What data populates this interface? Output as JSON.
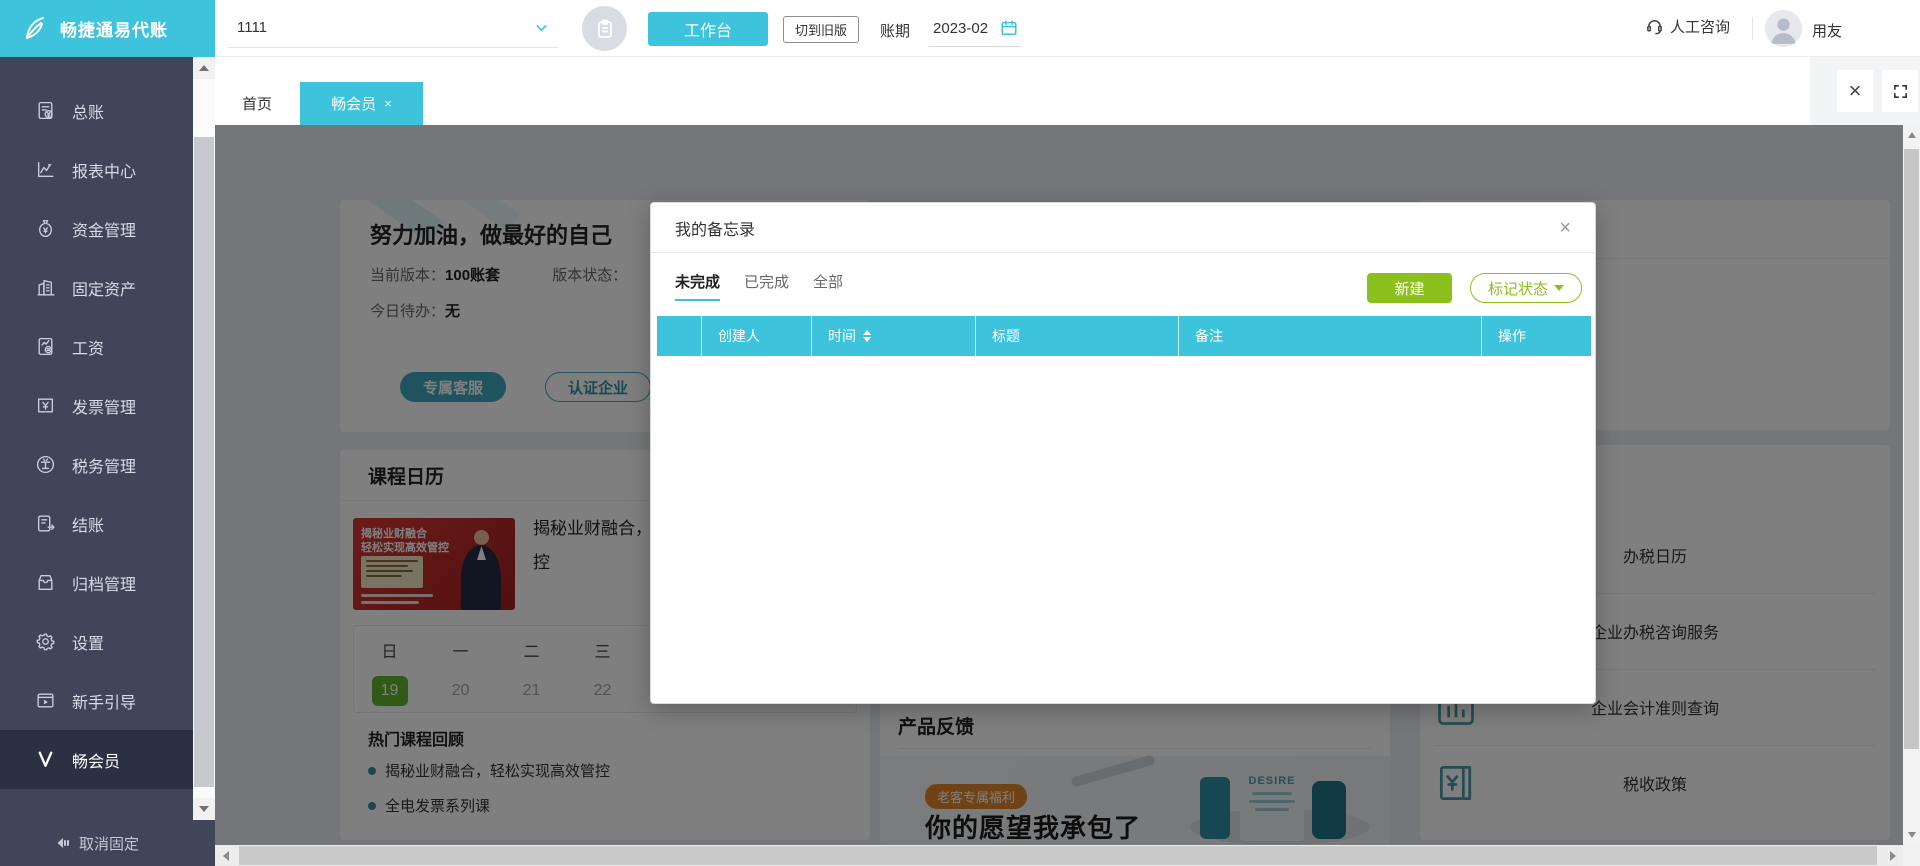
{
  "brand": {
    "logo_text": "畅捷通易代账"
  },
  "header": {
    "account_value": "1111",
    "workbench_button": "工作台",
    "switch_old_button": "切到旧版",
    "period_label": "账期",
    "period_value": "2023-02",
    "support_label": "人工咨询",
    "user_name": "用友"
  },
  "tabbar": {
    "home_tab": "首页",
    "member_tab": "畅会员",
    "tab_close_glyph": "×",
    "content_close_glyph": "×"
  },
  "sidebar": {
    "items": [
      {
        "label": "总账",
        "icon": "ledger-icon"
      },
      {
        "label": "报表中心",
        "icon": "report-icon"
      },
      {
        "label": "资金管理",
        "icon": "funds-icon"
      },
      {
        "label": "固定资产",
        "icon": "fixed-assets-icon"
      },
      {
        "label": "工资",
        "icon": "payroll-icon"
      },
      {
        "label": "发票管理",
        "icon": "invoice-icon"
      },
      {
        "label": "税务管理",
        "icon": "tax-icon"
      },
      {
        "label": "结账",
        "icon": "closing-icon"
      },
      {
        "label": "归档管理",
        "icon": "archive-icon"
      },
      {
        "label": "设置",
        "icon": "settings-icon"
      },
      {
        "label": "新手引导",
        "icon": "guide-icon"
      },
      {
        "label": "畅会员",
        "icon": "vip-icon",
        "active": true
      }
    ],
    "unpin_label": "取消固定"
  },
  "welcome_card": {
    "title": "努力加油，做最好的自己",
    "version_label": "当前版本：",
    "version_value": "100账套",
    "status_label": "版本状态：",
    "todo_label": "今日待办：",
    "todo_value": "无",
    "service_button": "专属客服",
    "certify_button": "认证企业"
  },
  "course_card": {
    "title": "课程日历",
    "banner_line1": "揭秘业财融合",
    "banner_line2": "轻松实现高效管控",
    "course_title": "揭秘业财融合，轻松实现高效管控",
    "calendar": {
      "headers": [
        "日",
        "一",
        "二",
        "三"
      ],
      "dates": [
        "19",
        "20",
        "21",
        "22"
      ],
      "active_date": "19"
    },
    "hot_title": "热门课程回顾",
    "hot_items": [
      "揭秘业财融合，轻松实现高效管控",
      "全电发票系列课"
    ]
  },
  "feedback_card": {
    "title": "产品反馈",
    "badge": "老客专属福利",
    "slogan": "你的愿望我承包了",
    "illustration_text": "DESIRE"
  },
  "tax_card": {
    "items": [
      "办税日历",
      "企业办税咨询服务",
      "企业会计准则查询",
      "税收政策"
    ]
  },
  "modal": {
    "title": "我的备忘录",
    "close_glyph": "×",
    "tabs": [
      "未完成",
      "已完成",
      "全部"
    ],
    "new_button": "新建",
    "mark_button": "标记状态",
    "columns": [
      "创建人",
      "时间",
      "标题",
      "备注",
      "操作"
    ]
  },
  "colors": {
    "brand_cyan": "#3ec3dc",
    "sidebar_bg": "#404659",
    "sidebar_active_bg": "#2b3043",
    "button_green": "#8cc11d",
    "teal": "#3fa9bd",
    "calendar_active_green": "#62b52e",
    "badge_orange": "#e0862c",
    "banner_red": "#c53331"
  }
}
